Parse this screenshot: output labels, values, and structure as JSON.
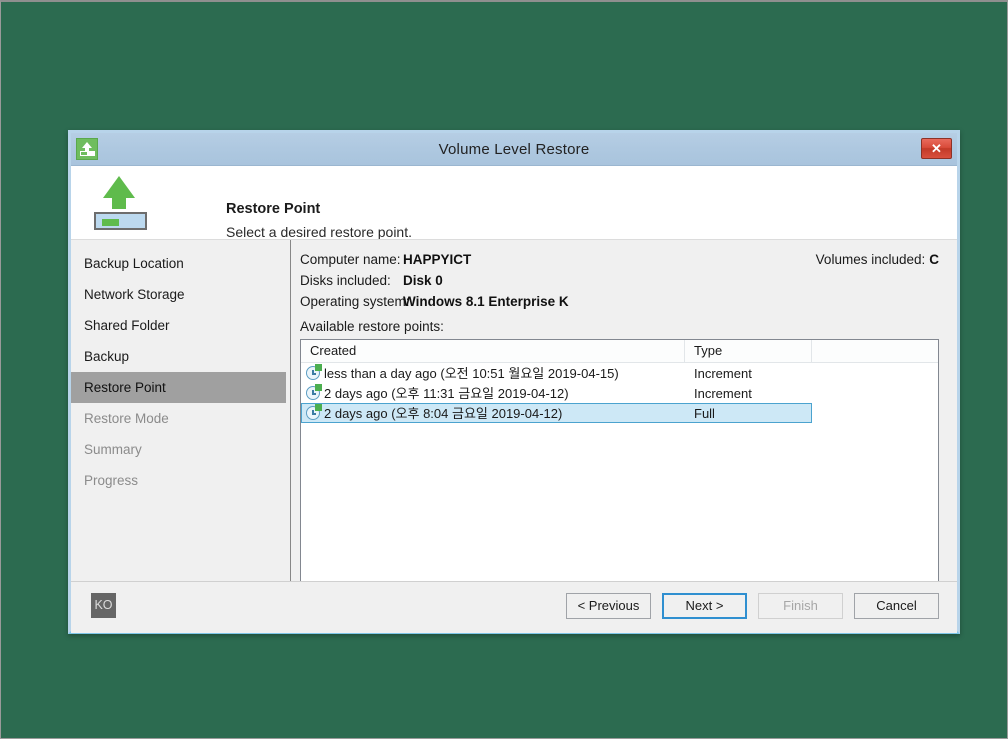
{
  "window": {
    "title": "Volume Level Restore",
    "title_icon": "restore-app-icon",
    "close_label": "✕"
  },
  "banner": {
    "icon": "restore-arrow-icon",
    "heading": "Restore Point",
    "subheading": "Select a desired restore point."
  },
  "sidebar": {
    "items": [
      {
        "label": "Backup Location",
        "state": "normal"
      },
      {
        "label": "Network Storage",
        "state": "normal"
      },
      {
        "label": "Shared Folder",
        "state": "normal"
      },
      {
        "label": "Backup",
        "state": "normal"
      },
      {
        "label": "Restore Point",
        "state": "selected"
      },
      {
        "label": "Restore Mode",
        "state": "disabled"
      },
      {
        "label": "Summary",
        "state": "disabled"
      },
      {
        "label": "Progress",
        "state": "disabled"
      }
    ]
  },
  "info": {
    "computer_name_label": "Computer name:",
    "computer_name_value": "HAPPYICT",
    "disks_label": "Disks included:",
    "disks_value": "Disk 0",
    "os_label": "Operating system:",
    "os_value": "Windows 8.1 Enterprise K",
    "volumes_label": "Volumes included:",
    "volumes_value": "C",
    "available_label": "Available restore points:"
  },
  "table": {
    "columns": [
      "Created",
      "Type",
      ""
    ],
    "rows": [
      {
        "icon": "restore-point-clock-icon",
        "created": "less than a day ago (오전 10:51 월요일 2019-04-15)",
        "type": "Increment",
        "selected": false
      },
      {
        "icon": "restore-point-clock-icon",
        "created": "2 days ago (오후 11:31 금요일 2019-04-12)",
        "type": "Increment",
        "selected": false
      },
      {
        "icon": "restore-point-clock-icon",
        "created": "2 days ago (오후 8:04 금요일 2019-04-12)",
        "type": "Full",
        "selected": true
      }
    ]
  },
  "footer": {
    "language_badge": "KO",
    "buttons": [
      {
        "label": "< Previous",
        "state": "normal"
      },
      {
        "label": "Next >",
        "state": "primary"
      },
      {
        "label": "Finish",
        "state": "disabled"
      },
      {
        "label": "Cancel",
        "state": "normal"
      }
    ]
  },
  "colors": {
    "desktop": "#2c6b50",
    "titlebar": "#aec8e0",
    "selection": "#cde8f6",
    "selection_border": "#4ba3cf",
    "sidebar_selected": "#a0a0a0",
    "accent_green": "#5fbb4c",
    "close_red": "#d94b3a"
  }
}
